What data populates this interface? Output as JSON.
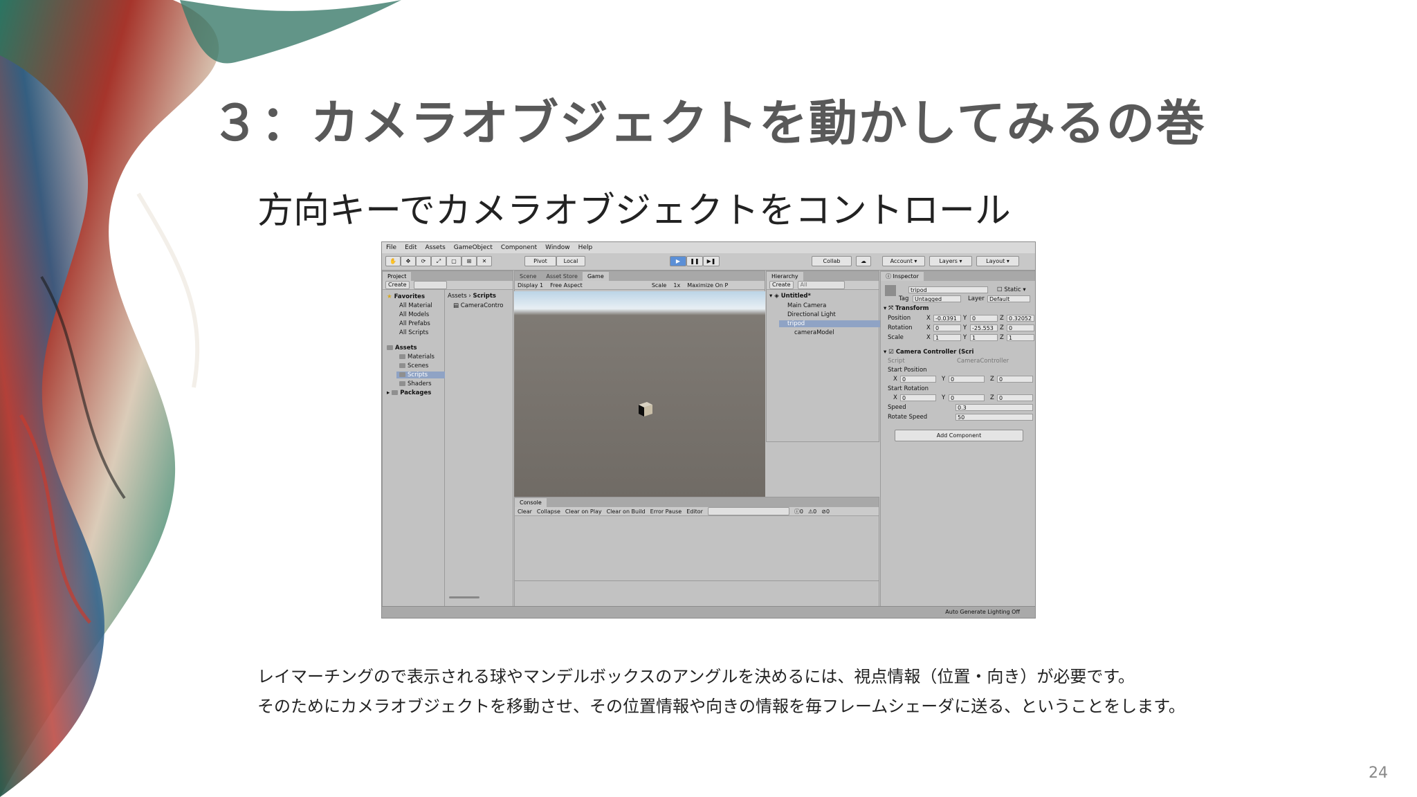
{
  "slide": {
    "title": "３：カメラオブジェクトを動かしてみるの巻",
    "subtitle": "方向キーでカメラオブジェクトをコントロール",
    "body_line1": "レイマーチングので表示される球やマンデルボックスのアングルを決めるには、視点情報（位置・向き）が必要です。",
    "body_line2": "そのためにカメラオブジェクトを移動させ、その位置情報や向きの情報を毎フレームシェーダに送る、ということをします。",
    "page_number": "24"
  },
  "unity": {
    "menu": [
      "File",
      "Edit",
      "Assets",
      "GameObject",
      "Component",
      "Window",
      "Help"
    ],
    "toolbar": {
      "pivot": "Pivot",
      "local": "Local",
      "collab": "Collab",
      "account": "Account",
      "layers": "Layers",
      "layout": "Layout"
    },
    "project": {
      "tab": "Project",
      "create": "Create",
      "favorites": "Favorites",
      "favorite_items": [
        "All Material",
        "All Models",
        "All Prefabs",
        "All Scripts"
      ],
      "assets": "Assets",
      "asset_folders": [
        "Materials",
        "Scenes",
        "Scripts",
        "Shaders"
      ],
      "packages": "Packages",
      "breadcrumb_root": "Assets",
      "breadcrumb_current": "Scripts",
      "file": "CameraContro"
    },
    "game": {
      "tabs": [
        "Scene",
        "Asset Store",
        "Game"
      ],
      "display": "Display 1",
      "aspect": "Free Aspect",
      "scale_label": "Scale",
      "scale_value": "1x",
      "maximize": "Maximize On P"
    },
    "hierarchy": {
      "tab": "Hierarchy",
      "create": "Create",
      "search": "All",
      "scene": "Untitled*",
      "items": [
        "Main Camera",
        "Directional Light",
        "tripod",
        "cameraModel"
      ]
    },
    "inspector": {
      "tab": "Inspector",
      "object_name": "tripod",
      "static": "Static",
      "tag_label": "Tag",
      "tag": "Untagged",
      "layer_label": "Layer",
      "layer": "Default",
      "transform": "Transform",
      "position_label": "Position",
      "rotation_label": "Rotation",
      "scale_label": "Scale",
      "position": [
        "-0.0391",
        "0",
        "0.32052"
      ],
      "rotation": [
        "0",
        "-25.553",
        "0"
      ],
      "scale": [
        "1",
        "1",
        "1"
      ],
      "component": "Camera Controller (Scri",
      "script_label": "Script",
      "script_value": "CameraController",
      "start_position_label": "Start Position",
      "start_position": [
        "0",
        "0",
        "0"
      ],
      "start_rotation_label": "Start Rotation",
      "start_rotation": [
        "0",
        "0",
        "0"
      ],
      "speed_label": "Speed",
      "speed": "0.3",
      "rotate_speed_label": "Rotate Speed",
      "rotate_speed": "50",
      "add_component": "Add Component",
      "axis_x": "X",
      "axis_y": "Y",
      "axis_z": "Z"
    },
    "console": {
      "tab": "Console",
      "buttons": [
        "Clear",
        "Collapse",
        "Clear on Play",
        "Clear on Build",
        "Error Pause",
        "Editor"
      ],
      "counts": [
        "0",
        "0",
        "0"
      ]
    },
    "status": "Auto Generate Lighting Off"
  },
  "colors": {
    "title": "#595959",
    "editor_bg": "#c2c2c2",
    "selection": "#8fa3c5",
    "play_active": "#5b8fd6"
  }
}
